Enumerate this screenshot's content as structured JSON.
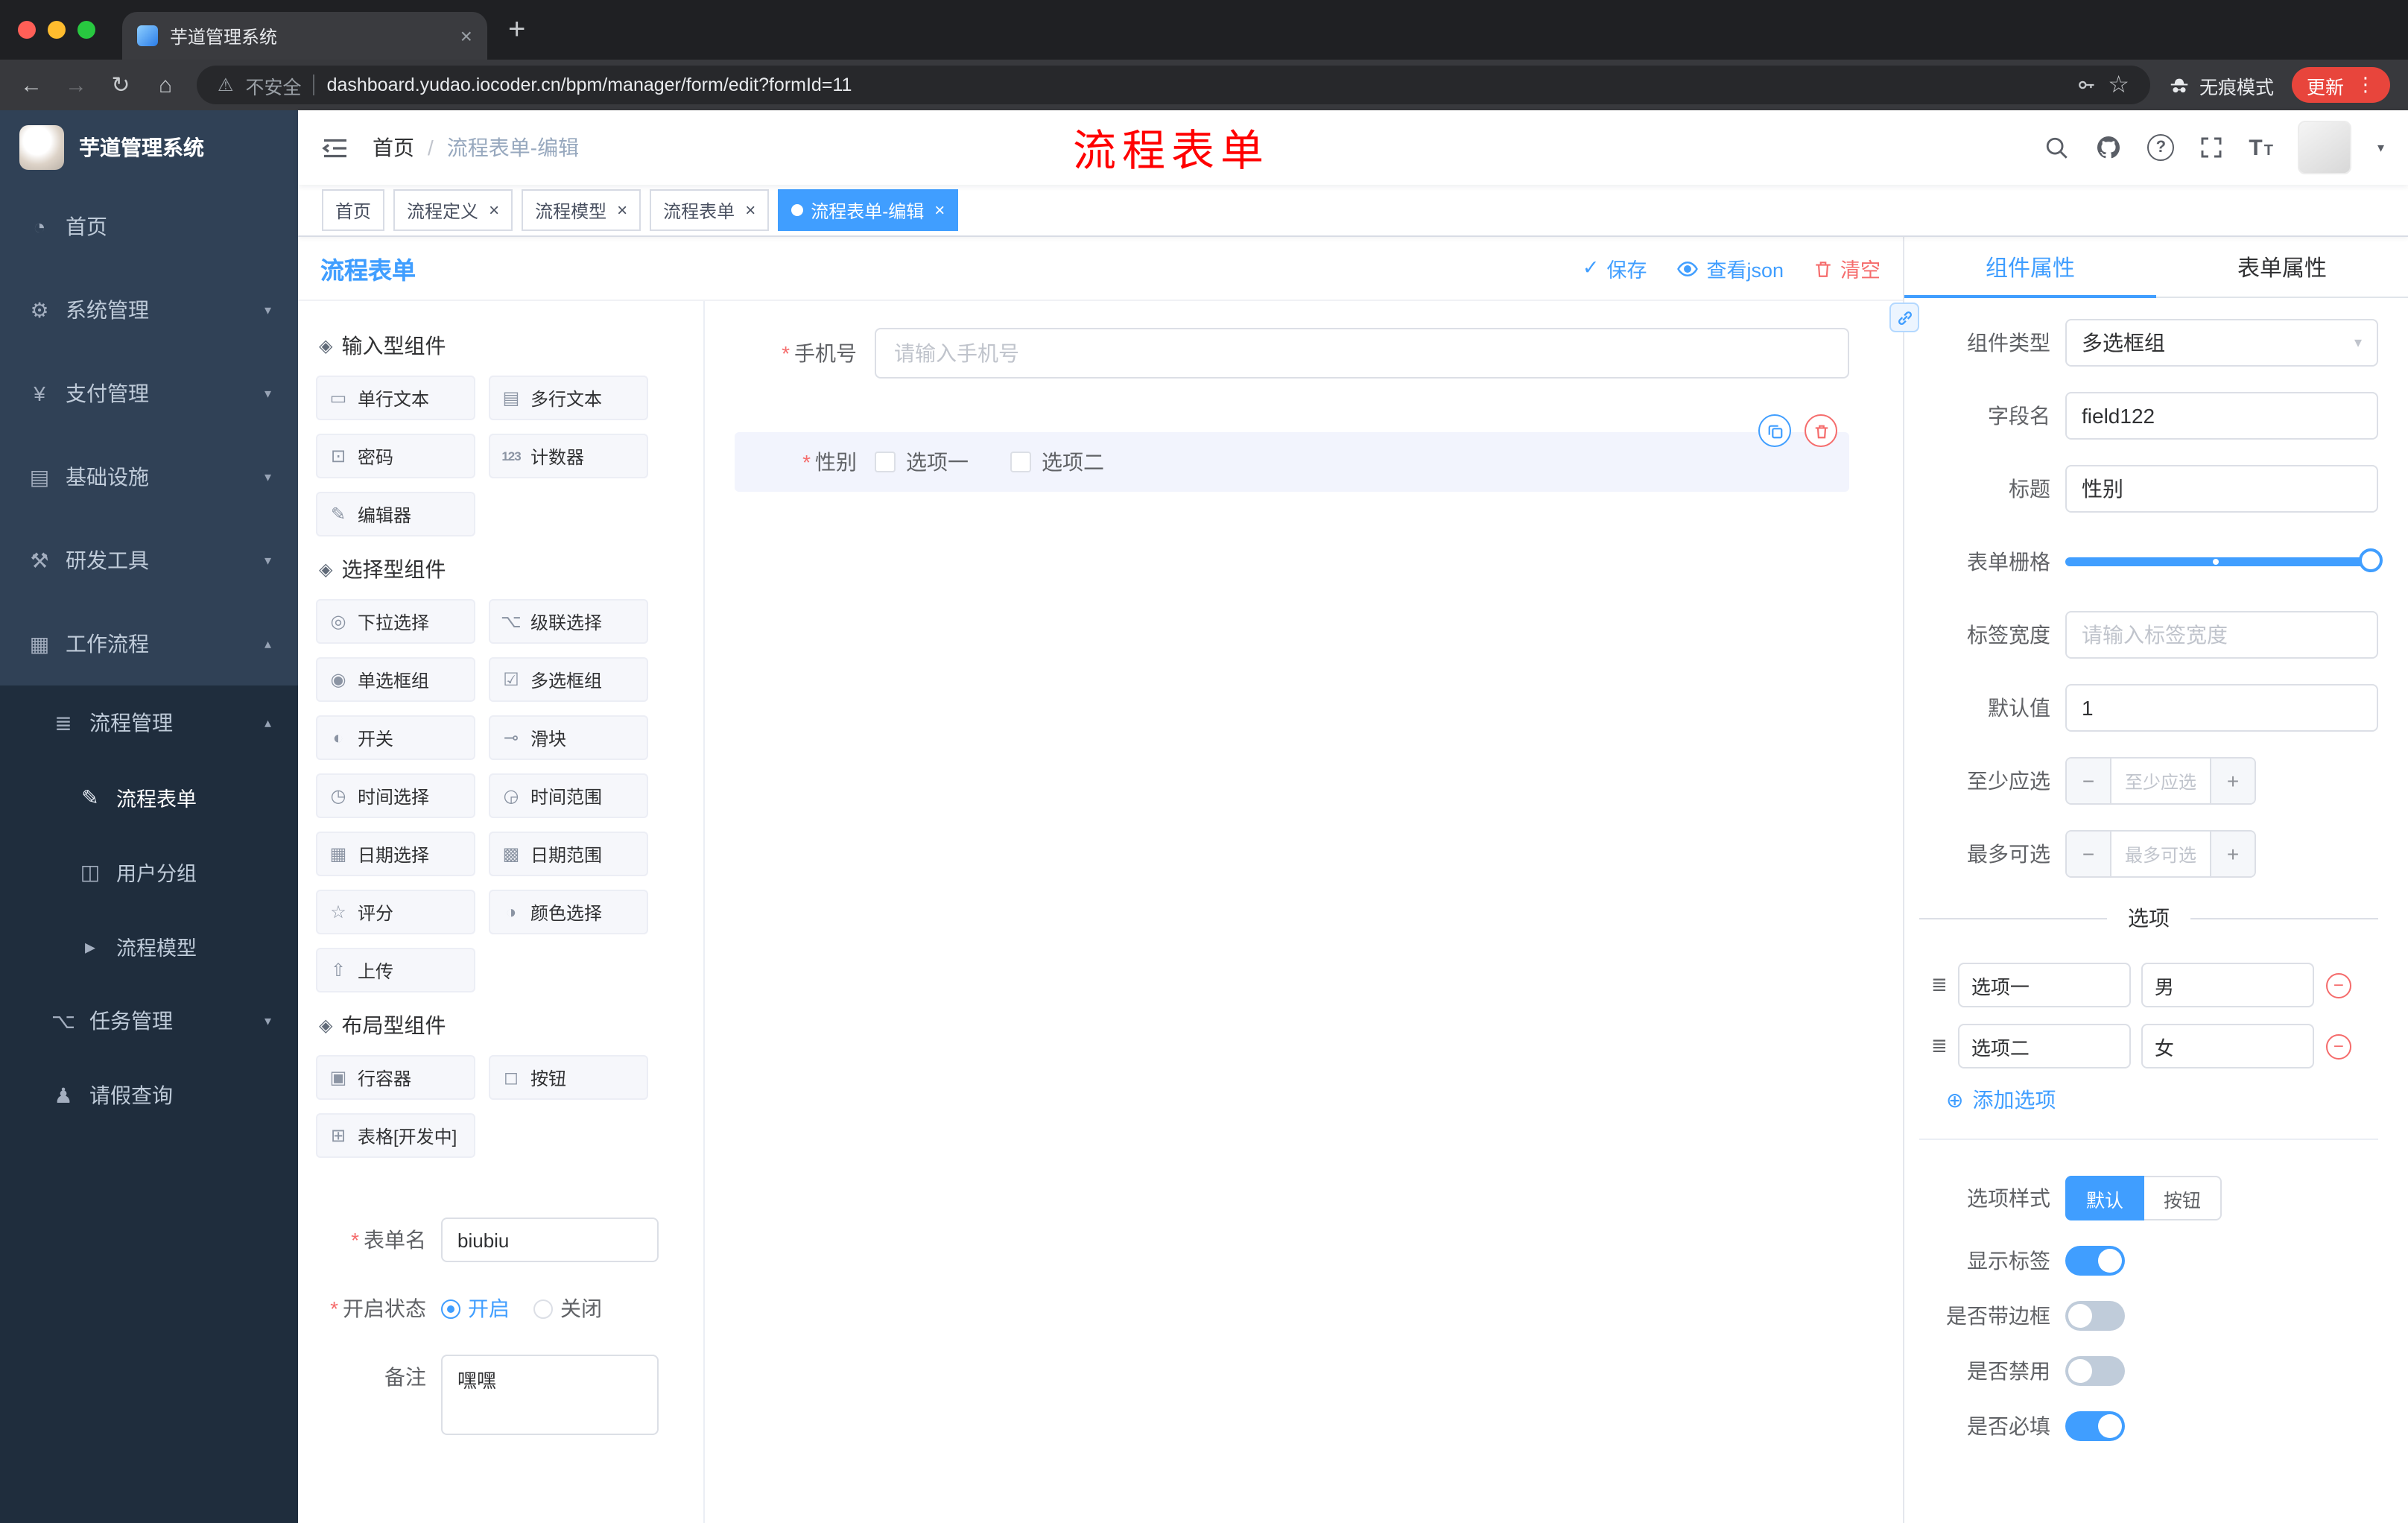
{
  "browser": {
    "tab_title": "芋道管理系统",
    "url": "dashboard.yudao.iocoder.cn/bpm/manager/form/edit?formId=11",
    "security_label": "不安全",
    "incognito_label": "无痕模式",
    "update_label": "更新"
  },
  "sidebar": {
    "title": "芋道管理系统",
    "menu": {
      "home": "首页",
      "system": "系统管理",
      "payment": "支付管理",
      "infra": "基础设施",
      "devtools": "研发工具",
      "workflow": "工作流程",
      "process_mgmt": "流程管理",
      "process_form": "流程表单",
      "user_group": "用户分组",
      "process_model": "流程模型",
      "task_mgmt": "任务管理",
      "leave_query": "请假查询"
    }
  },
  "header": {
    "breadcrumb_home": "首页",
    "breadcrumb_current": "流程表单-编辑",
    "overlay_title": "流程表单"
  },
  "tags": {
    "home": "首页",
    "process_def": "流程定义",
    "process_model": "流程模型",
    "process_form": "流程表单",
    "process_form_edit": "流程表单-编辑"
  },
  "editor": {
    "panel_title": "流程表单",
    "save": "保存",
    "view_json": "查看json",
    "clear": "清空"
  },
  "palette": {
    "group_input": "输入型组件",
    "input_items": [
      "单行文本",
      "多行文本",
      "密码",
      "计数器",
      "编辑器"
    ],
    "group_select": "选择型组件",
    "select_items": [
      "下拉选择",
      "级联选择",
      "单选框组",
      "多选框组",
      "开关",
      "滑块",
      "时间选择",
      "时间范围",
      "日期选择",
      "日期范围",
      "评分",
      "颜色选择",
      "上传"
    ],
    "group_layout": "布局型组件",
    "layout_items": [
      "行容器",
      "按钮",
      "表格[开发中]"
    ]
  },
  "form_settings": {
    "name_label": "表单名",
    "name_value": "biubiu",
    "status_label": "开启状态",
    "status_on": "开启",
    "status_off": "关闭",
    "remark_label": "备注",
    "remark_value": "嘿嘿"
  },
  "canvas": {
    "phone_label": "手机号",
    "phone_placeholder": "请输入手机号",
    "gender_label": "性别",
    "gender_option1": "选项一",
    "gender_option2": "选项二"
  },
  "props": {
    "tab_component": "组件属性",
    "tab_form": "表单属性",
    "type_label": "组件类型",
    "type_value": "多选框组",
    "field_label": "字段名",
    "field_value": "field122",
    "title_label": "标题",
    "title_value": "性别",
    "grid_label": "表单栅格",
    "width_label": "标签宽度",
    "width_placeholder": "请输入标签宽度",
    "default_label": "默认值",
    "default_value": "1",
    "min_label": "至少应选",
    "min_placeholder": "至少应选",
    "max_label": "最多可选",
    "max_placeholder": "最多可选",
    "options_title": "选项",
    "option1_label": "选项一",
    "option1_value": "男",
    "option2_label": "选项二",
    "option2_value": "女",
    "add_option": "添加选项",
    "style_label": "选项样式",
    "style_default": "默认",
    "style_button": "按钮",
    "show_label": "显示标签",
    "border_label": "是否带边框",
    "disabled_label": "是否禁用",
    "required_label": "是否必填"
  },
  "colors": {
    "primary": "#409EFF",
    "danger": "#F56C6C",
    "sidebar_bg": "#304156",
    "submenu_bg": "#1F2D3D",
    "overlay_red": "#FF0000",
    "tab_active_bg": "#409EFF"
  }
}
